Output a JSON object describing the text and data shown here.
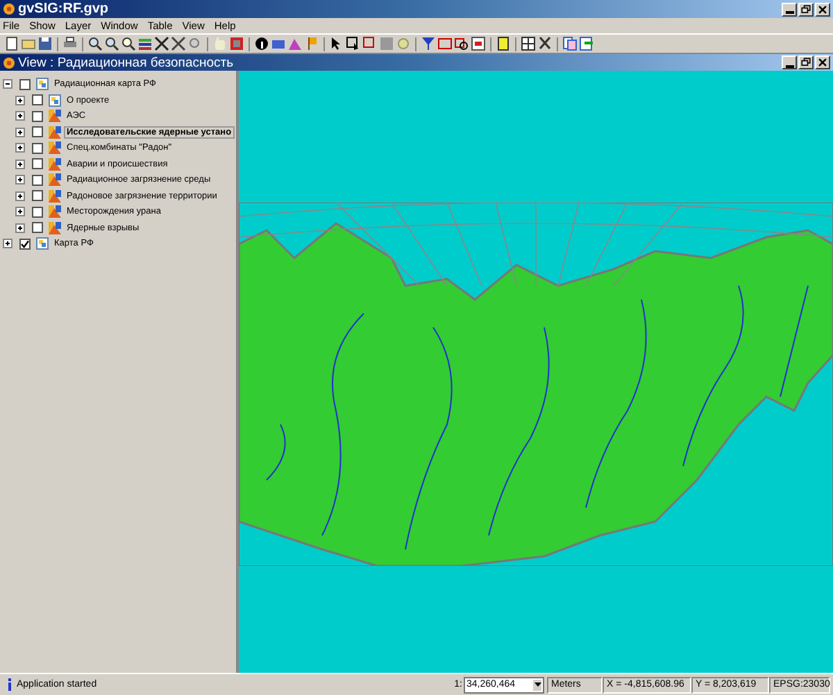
{
  "window": {
    "title": "gvSIG:RF.gvp"
  },
  "menu": [
    "File",
    "Show",
    "Layer",
    "Window",
    "Table",
    "View",
    "Help"
  ],
  "view": {
    "title": "View : Радиационная безопасность"
  },
  "toc": [
    {
      "label": "Радиационная карта РФ",
      "kind": "group",
      "checked": false,
      "expanded": true,
      "selected": false,
      "children": [
        {
          "label": "О проекте",
          "kind": "group",
          "checked": false,
          "expanded": false,
          "selected": false
        },
        {
          "label": "АЭС",
          "kind": "layer",
          "checked": false,
          "expanded": false,
          "selected": false
        },
        {
          "label": "Исследовательские ядерные устано",
          "kind": "layer",
          "checked": false,
          "expanded": false,
          "selected": true
        },
        {
          "label": "Спец.комбинаты \"Радон\"",
          "kind": "layer",
          "checked": false,
          "expanded": false,
          "selected": false
        },
        {
          "label": "Аварии и происшествия",
          "kind": "layer",
          "checked": false,
          "expanded": false,
          "selected": false
        },
        {
          "label": "Радиационное загрязнение среды",
          "kind": "layer",
          "checked": false,
          "expanded": false,
          "selected": false
        },
        {
          "label": "Радоновое загрязнение территории",
          "kind": "layer",
          "checked": false,
          "expanded": false,
          "selected": false
        },
        {
          "label": "Месторождения урана",
          "kind": "layer",
          "checked": false,
          "expanded": false,
          "selected": false
        },
        {
          "label": "Ядерные взрывы",
          "kind": "layer",
          "checked": false,
          "expanded": false,
          "selected": false
        }
      ]
    },
    {
      "label": "Карта РФ",
      "kind": "group",
      "checked": true,
      "expanded": false,
      "selected": false
    }
  ],
  "status_bar": {
    "message": "Application started",
    "scale_prefix": "1:",
    "scale": "34,260,464",
    "units": "Meters",
    "x": "X = -4,815,608.96",
    "y": "Y = 8,203,619",
    "crs": "EPSG:23030"
  }
}
